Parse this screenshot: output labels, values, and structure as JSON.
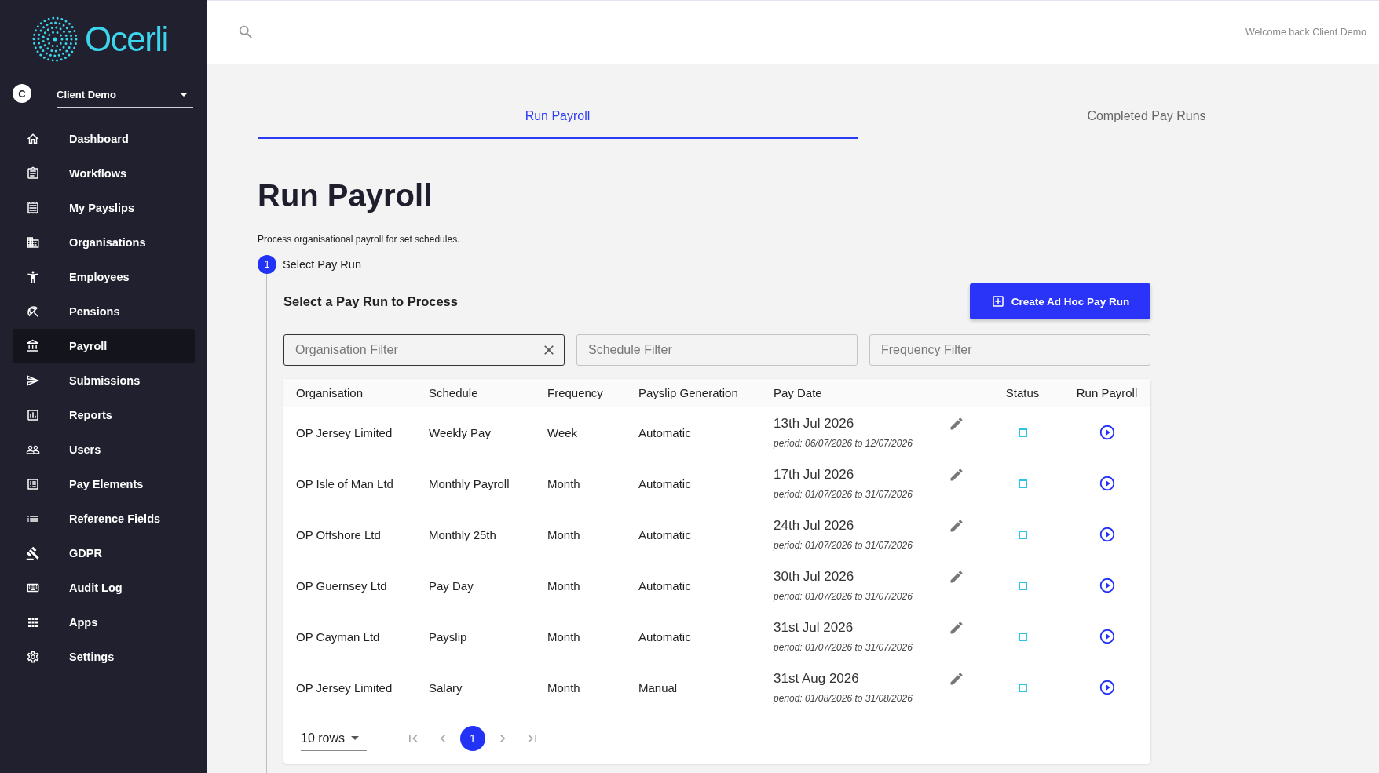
{
  "sidebar": {
    "logo": "Ocerli",
    "account": {
      "initial": "C",
      "name": "Client Demo"
    },
    "items": [
      {
        "label": "Dashboard",
        "selected": false
      },
      {
        "label": "Workflows",
        "selected": false
      },
      {
        "label": "My Payslips",
        "selected": false
      },
      {
        "label": "Organisations",
        "selected": false
      },
      {
        "label": "Employees",
        "selected": false
      },
      {
        "label": "Pensions",
        "selected": false
      },
      {
        "label": "Payroll",
        "selected": true
      },
      {
        "label": "Submissions",
        "selected": false
      },
      {
        "label": "Reports",
        "selected": false
      },
      {
        "label": "Users",
        "selected": false
      },
      {
        "label": "Pay Elements",
        "selected": false
      },
      {
        "label": "Reference Fields",
        "selected": false
      },
      {
        "label": "GDPR",
        "selected": false
      },
      {
        "label": "Audit Log",
        "selected": false
      },
      {
        "label": "Apps",
        "selected": false
      },
      {
        "label": "Settings",
        "selected": false
      }
    ]
  },
  "header": {
    "welcome": "Welcome back Client Demo"
  },
  "tabs": [
    {
      "label": "Run Payroll",
      "selected": true
    },
    {
      "label": "Completed Pay Runs",
      "selected": false
    }
  ],
  "page": {
    "title": "Run Payroll",
    "description": "Process organisational payroll for set schedules."
  },
  "step": {
    "number": "1",
    "label": "Select Pay Run"
  },
  "section": {
    "title": "Select a Pay Run to Process",
    "button": "Create Ad Hoc Pay Run"
  },
  "filters": [
    {
      "placeholder": "Organisation Filter",
      "active": true
    },
    {
      "placeholder": "Schedule Filter",
      "active": false
    },
    {
      "placeholder": "Frequency Filter",
      "active": false
    }
  ],
  "table": {
    "columns": [
      "Organisation",
      "Schedule",
      "Frequency",
      "Payslip Generation",
      "Pay Date",
      "Status",
      "Run Payroll"
    ],
    "rows": [
      {
        "organisation": "OP Jersey Limited",
        "schedule": "Weekly Pay",
        "frequency": "Week",
        "payslip_generation": "Automatic",
        "pay_date": "13th Jul 2026",
        "period": "period: 06/07/2026 to 12/07/2026"
      },
      {
        "organisation": "OP Isle of Man Ltd",
        "schedule": "Monthly Payroll",
        "frequency": "Month",
        "payslip_generation": "Automatic",
        "pay_date": "17th Jul 2026",
        "period": "period: 01/07/2026 to 31/07/2026"
      },
      {
        "organisation": "OP Offshore Ltd",
        "schedule": "Monthly 25th",
        "frequency": "Month",
        "payslip_generation": "Automatic",
        "pay_date": "24th Jul 2026",
        "period": "period: 01/07/2026 to 31/07/2026"
      },
      {
        "organisation": "OP Guernsey Ltd",
        "schedule": "Pay Day",
        "frequency": "Month",
        "payslip_generation": "Automatic",
        "pay_date": "30th Jul 2026",
        "period": "period: 01/07/2026 to 31/07/2026"
      },
      {
        "organisation": "OP Cayman Ltd",
        "schedule": "Payslip",
        "frequency": "Month",
        "payslip_generation": "Automatic",
        "pay_date": "31st Jul 2026",
        "period": "period: 01/07/2026 to 31/07/2026"
      },
      {
        "organisation": "OP Jersey Limited",
        "schedule": "Salary",
        "frequency": "Month",
        "payslip_generation": "Manual",
        "pay_date": "31st Aug 2026",
        "period": "period: 01/08/2026 to 31/08/2026"
      }
    ]
  },
  "pagination": {
    "rows_per_page": "10 rows",
    "pages": [
      {
        "label": "1",
        "selected": true
      }
    ]
  }
}
